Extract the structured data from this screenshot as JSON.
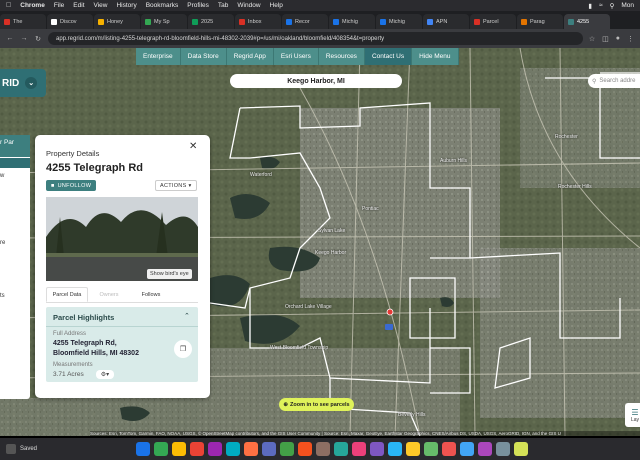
{
  "menubar": {
    "app_name": "Chrome",
    "items": [
      "File",
      "Edit",
      "View",
      "History",
      "Bookmarks",
      "Profiles",
      "Tab",
      "Window",
      "Help"
    ],
    "time": "Mon"
  },
  "tabs": [
    {
      "label": "The",
      "color": "#d93025"
    },
    {
      "label": "Discov",
      "color": "#ffffff"
    },
    {
      "label": "Honey",
      "color": "#f6b100"
    },
    {
      "label": "My Sp",
      "color": "#34a853"
    },
    {
      "label": "2025",
      "color": "#0f9d58"
    },
    {
      "label": "Inbox",
      "color": "#d93025"
    },
    {
      "label": "Recor",
      "color": "#1a73e8"
    },
    {
      "label": "Michig",
      "color": "#1a73e8"
    },
    {
      "label": "Michig",
      "color": "#1a73e8"
    },
    {
      "label": "APN",
      "color": "#4285f4"
    },
    {
      "label": "Parcel",
      "color": "#d93025"
    },
    {
      "label": "Parag",
      "color": "#e37400"
    },
    {
      "label": "4255",
      "color": "#3d7f7f",
      "active": true
    }
  ],
  "address_bar": {
    "url": "app.regrid.com/m/listing-4255-telegraph-rd-bloomfield-hills-mi-48302-2039#p=/us/mi/oakland/bloomfield/408354&t=property"
  },
  "topnav": {
    "items": [
      "Enterprise",
      "Data Store",
      "Regrid App",
      "Esri Users",
      "Resources",
      "Contact Us",
      "Hide Menu"
    ],
    "active_index": 5
  },
  "logo": {
    "text": "RID"
  },
  "location_search": {
    "value": "Keego Harbor, MI"
  },
  "address_search": {
    "placeholder": "Search addre"
  },
  "side_sliver": {
    "header": "r Par",
    "items": [
      "w",
      "re",
      "ts"
    ]
  },
  "property_panel": {
    "title": "Property Details",
    "address": "4255 Telegraph Rd",
    "unfollow_label": "UNFOLLOW",
    "actions_label": "ACTIONS",
    "birds_eye_label": "Show bird's eye",
    "tabs": [
      "Parcel Data",
      "Owners",
      "Follows"
    ],
    "active_tab": 0,
    "highlights_title": "Parcel Highlights",
    "full_address_label": "Full Address",
    "full_address_line1": "4255 Telegraph Rd,",
    "full_address_line2": "Bloomfield Hills, MI 48302",
    "measurements_label": "Measurements",
    "acres_value": "3.71 Acres"
  },
  "map_labels": [
    "Waterford",
    "Pontiac",
    "Rochester",
    "Rochester Hills",
    "Keego Harbor",
    "Orchard Lake Village",
    "West Bloomfield Township",
    "Beverly Hills",
    "Sylvan Lake",
    "Auburn Hills"
  ],
  "zoom_button": {
    "label": "Zoom in to see parcels"
  },
  "layers_button": {
    "label": "Lay"
  },
  "attribution": "Sources: Esri, TomTom, Garmin, FAO, NOAA, USGS, © OpenStreetMap contributors, and the GIS User Community | Source: Esri, Maxar, GeoEye, Earthstar Geographics, CNES/Airbus DS, USDA, USGS, AeroGRID, IGN, and the GIS U",
  "dock": {
    "saved_label": "Saved"
  }
}
